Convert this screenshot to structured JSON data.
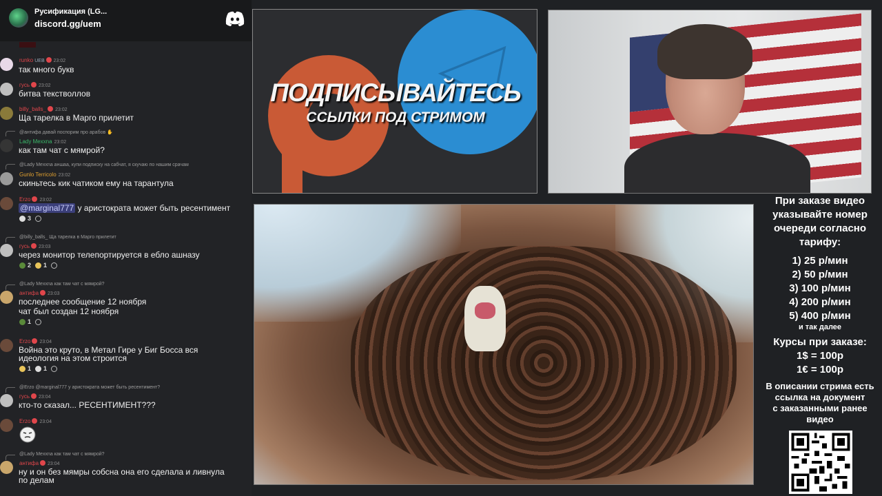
{
  "discord": {
    "server_name": "Русификация (LG...",
    "invite": "discord.gg/uem"
  },
  "chat": [
    {
      "user": "runko",
      "user_color": "#e0464b",
      "tag": "UEB",
      "time": "23:02",
      "text": "так много букв",
      "avatar_color": "#e8d9e8"
    },
    {
      "user": "гусь",
      "user_color": "#e0464b",
      "time": "23:02",
      "text": "битва текстволлов",
      "avatar_color": "#bfbfbf"
    },
    {
      "user": "billy_balls_",
      "user_color": "#e0464b",
      "time": "23:02",
      "text": "Ща тарелка в Марго прилетит",
      "avatar_color": "#8a7a3a"
    },
    {
      "reply": "@антифа давай поспорим про арабов ✋",
      "user": "Lady Mexxna",
      "user_color": "#3bb86a",
      "time": "23:02",
      "text": "как там чат с мямрой?",
      "avatar_color": "#353535"
    },
    {
      "reply": "@Lady Mexxna аншаа, купи подписку на сабчат, я скучаю по нашим срачам",
      "user": "Gunlo Terricolo",
      "user_color": "#e0a030",
      "time": "23:02",
      "text": "скиньтесь кик чатиком ему на тарантула",
      "avatar_color": "#9a9a9a"
    },
    {
      "user": "Erzo",
      "user_color": "#e0464b",
      "time": "23:02",
      "mention": "@marginal777",
      "text": " у аристократа может быть ресентимент",
      "avatar_color": "#6a4a3a",
      "reactions": [
        "3"
      ]
    },
    {
      "reply": "@billy_balls_ Ща тарелка в Марго прилетит",
      "user": "гусь",
      "user_color": "#e0464b",
      "time": "23:03",
      "text": "через монитор телепортируется в ебло ашназу",
      "avatar_color": "#bfbfbf",
      "reactions": [
        "2",
        "1"
      ]
    },
    {
      "reply": "@Lady Mexxna как там чат с мямрой?",
      "user": "антифа",
      "user_color": "#e0464b",
      "time": "23:03",
      "text": "последнее сообщение 12 ноября",
      "text2": "чат был создан 12 ноября",
      "avatar_color": "#c9a66b",
      "reactions": [
        "1"
      ]
    },
    {
      "user": "Erzo",
      "user_color": "#e0464b",
      "time": "23:04",
      "text": "Война это круто, в Метал Гире у Биг Босса вся",
      "text2": "идеология на этом строится",
      "avatar_color": "#6a4a3a",
      "reactions": [
        "1",
        "1"
      ]
    },
    {
      "reply": "@Erzo @marginal777 у аристократа может быть ресентимент?",
      "user": "гусь",
      "user_color": "#e0464b",
      "time": "23:04",
      "text": "кто-то сказал... РЕСЕНТИМЕНТ???",
      "avatar_color": "#bfbfbf"
    },
    {
      "user": "Erzo",
      "user_color": "#e0464b",
      "time": "23:04",
      "text": "",
      "avatar_color": "#6a4a3a"
    },
    {
      "reply": "@Lady Mexxna как там чат с мямрой?",
      "user": "антифа",
      "user_color": "#e0464b",
      "time": "23:04",
      "text": "ну и он без мямры собсна она его сделала и ливнула",
      "text2": "по делам",
      "avatar_color": "#c9a66b"
    }
  ],
  "banner": {
    "title": "ПОДПИСЫВАЙТЕСЬ",
    "subtitle": "ССЫЛКИ ПОД СТРИМОМ"
  },
  "info": {
    "heading": [
      "При заказе видео",
      "указывайте номер",
      "очереди согласно",
      "тарифу:"
    ],
    "prices": [
      "1) 25 р/мин",
      "2) 50 р/мин",
      "3) 100 р/мин",
      "4) 200 р/мин",
      "5) 400 р/мин"
    ],
    "and_so_on": "и так далее",
    "rates_title": "Курсы при заказе:",
    "rates": [
      "1$ = 100р",
      "1€ = 100р"
    ],
    "description": [
      "В описании стрима есть",
      "ссылка на документ",
      "с заказанными ранее",
      "видео"
    ]
  }
}
